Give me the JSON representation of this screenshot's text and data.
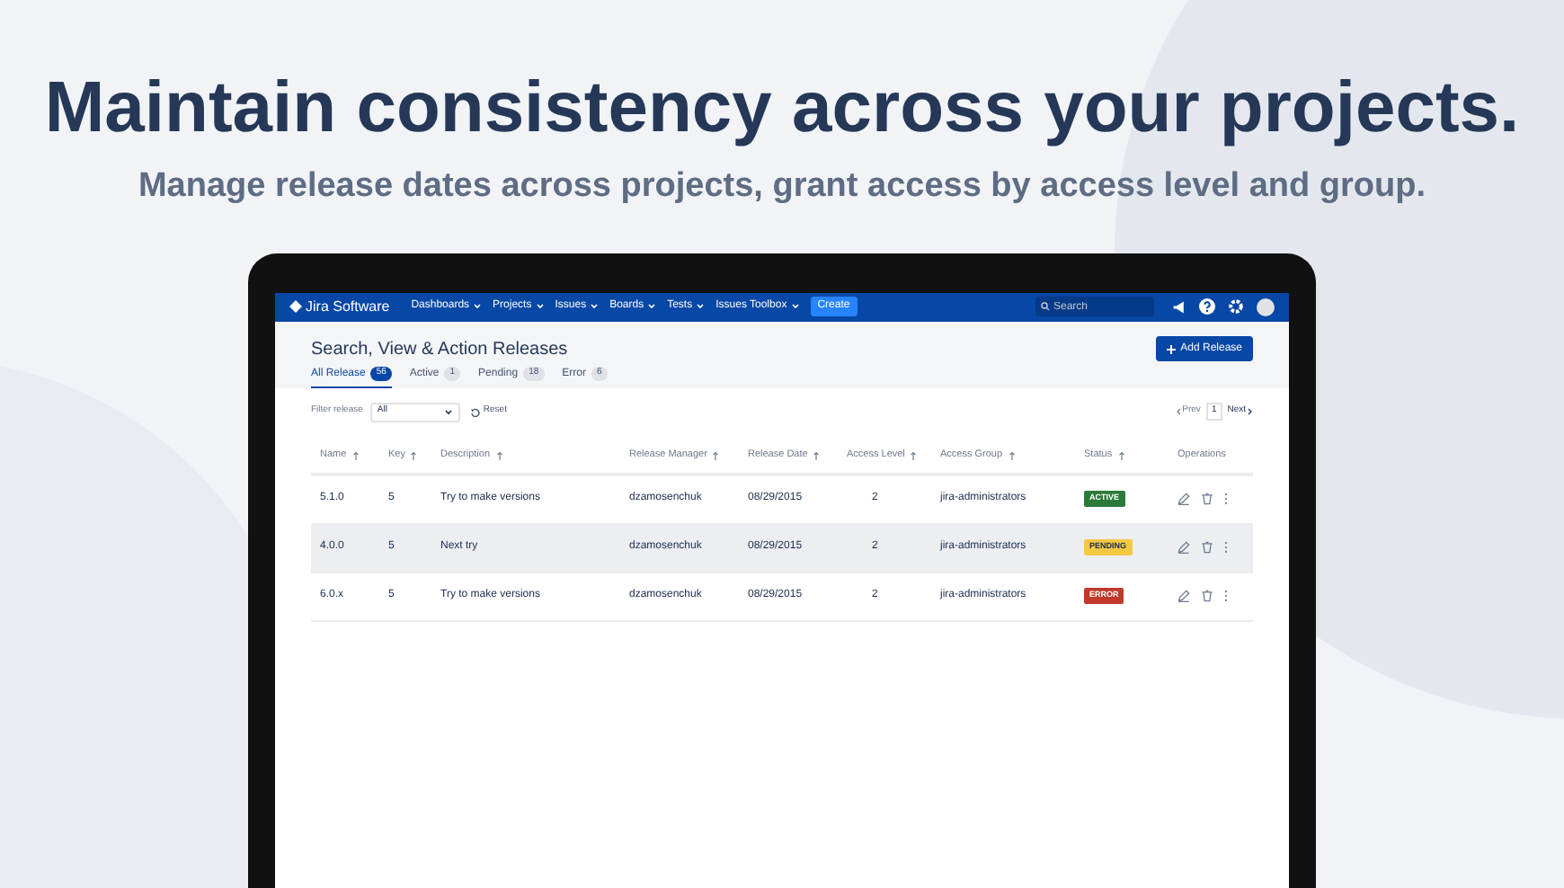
{
  "headline": "Maintain consistency across your projects.",
  "subheadline": "Manage release dates across projects, grant access by access level and group.",
  "app": {
    "logo": "Jira Software",
    "nav": [
      {
        "label": "Dashboards"
      },
      {
        "label": "Projects"
      },
      {
        "label": "Issues"
      },
      {
        "label": "Boards"
      },
      {
        "label": "Tests"
      },
      {
        "label": "Issues Toolbox"
      }
    ],
    "create_button": "Create",
    "search": {
      "placeholder": "Search"
    },
    "page_title": "Search, View & Action Releases",
    "add_button": "Add Release",
    "tabs": [
      {
        "label": "All Release",
        "count": "56",
        "selected": true
      },
      {
        "label": "Active",
        "count": "1",
        "selected": false
      },
      {
        "label": "Pending",
        "count": "18",
        "selected": false
      },
      {
        "label": "Error",
        "count": "6",
        "selected": false
      }
    ],
    "filter": {
      "label": "Filter release",
      "value": "All",
      "reset": "Reset"
    },
    "pagination": {
      "prev": "Prev",
      "page": "1",
      "next": "Next"
    },
    "table": {
      "columns": [
        {
          "label": "Name",
          "sortable": true
        },
        {
          "label": "Key",
          "sortable": true
        },
        {
          "label": "Description",
          "sortable": true
        },
        {
          "label": "Release Manager",
          "sortable": true
        },
        {
          "label": "Release Date",
          "sortable": true
        },
        {
          "label": "Access Level",
          "sortable": true
        },
        {
          "label": "Access Group",
          "sortable": true
        },
        {
          "label": "Status",
          "sortable": true
        },
        {
          "label": "Operations",
          "sortable": false
        }
      ],
      "rows": [
        {
          "name": "5.1.0",
          "key": "5",
          "description": "Try to make versions",
          "manager": "dzamosenchuk",
          "date": "08/29/2015",
          "level": "2",
          "group": "jira-administrators",
          "status": "ACTIVE",
          "kind": "active",
          "highlighted": false
        },
        {
          "name": "4.0.0",
          "key": "5",
          "description": "Next try",
          "manager": "dzamosenchuk",
          "date": "08/29/2015",
          "level": "2",
          "group": "jira-administrators",
          "status": "PENDING",
          "kind": "pending",
          "highlighted": true
        },
        {
          "name": "6.0.x",
          "key": "5",
          "description": "Try to make versions",
          "manager": "dzamosenchuk",
          "date": "08/29/2015",
          "level": "2",
          "group": "jira-administrators",
          "status": "ERROR",
          "kind": "error",
          "highlighted": false
        }
      ]
    }
  }
}
